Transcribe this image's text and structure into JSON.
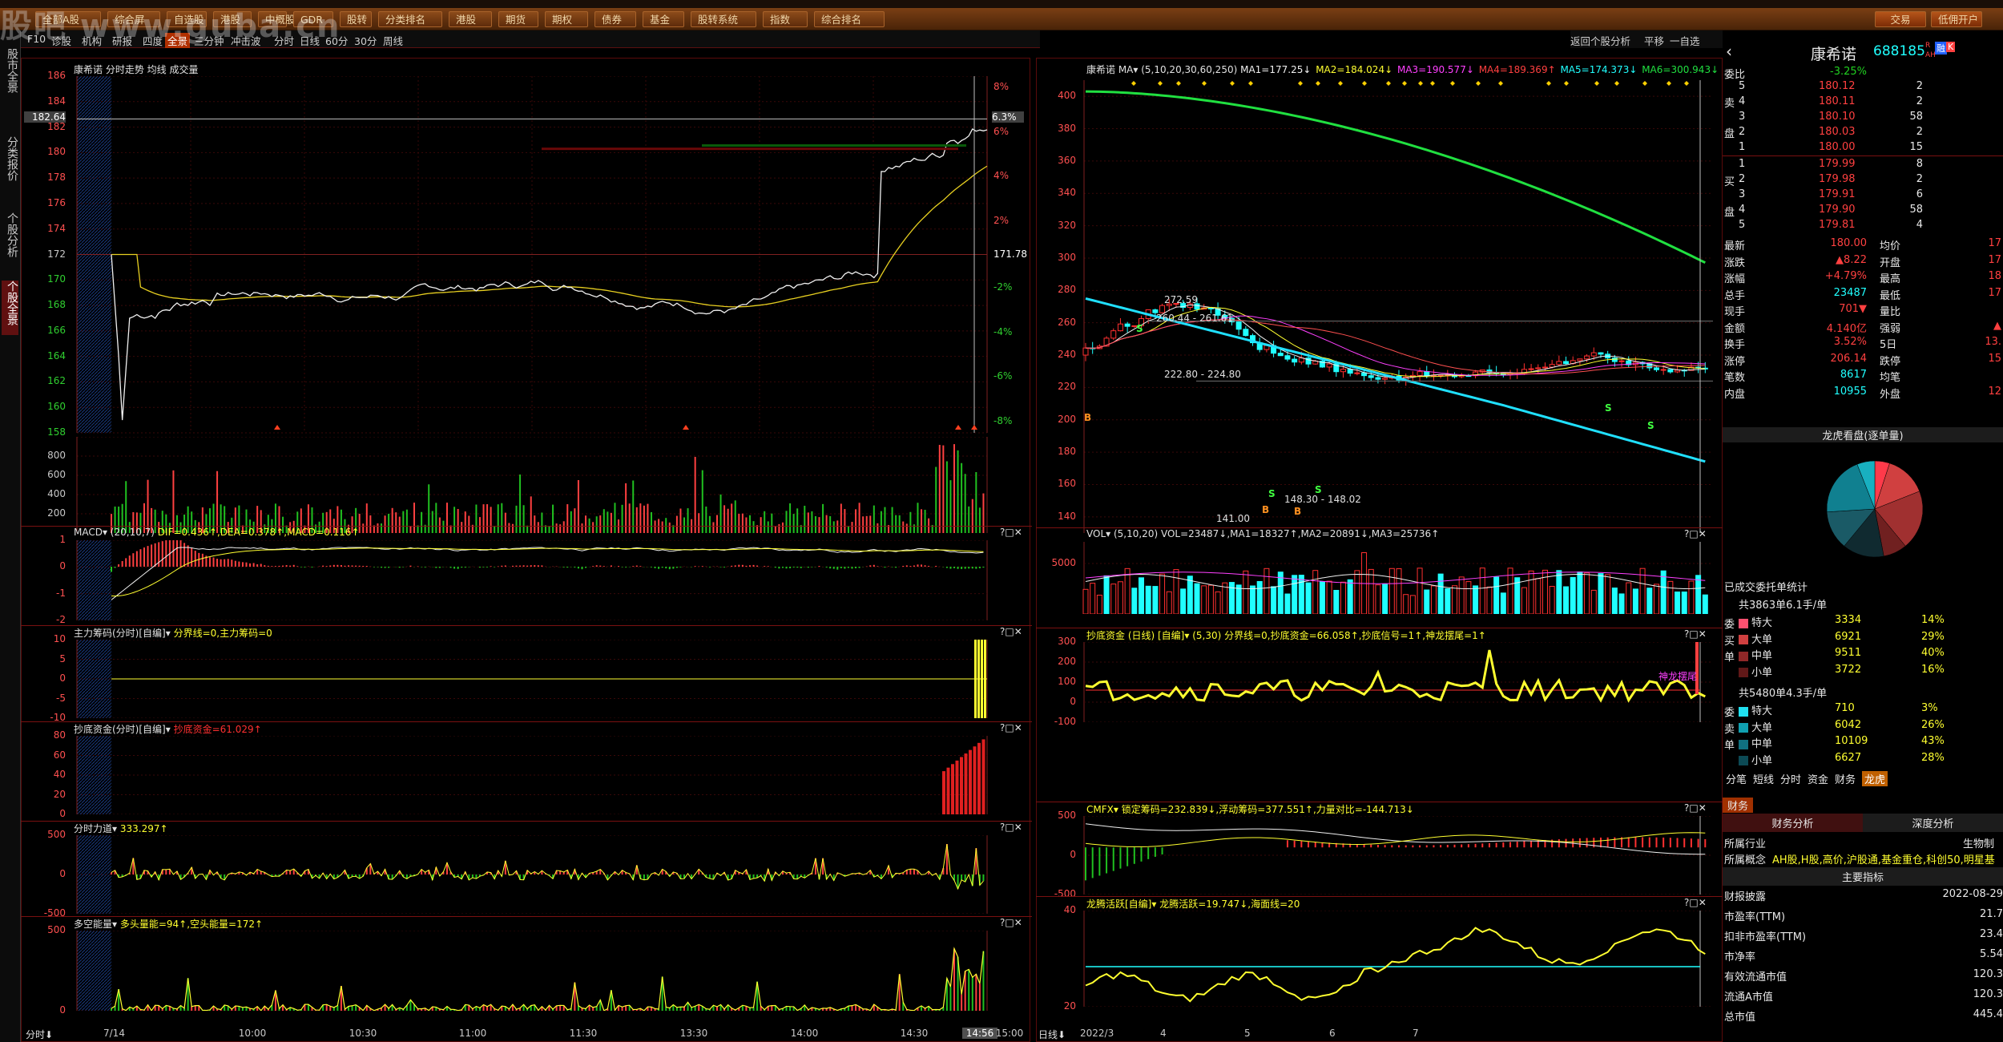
{
  "watermark": "股吧 www.guba.cn",
  "menu": [
    "全部",
    "全部A股",
    "综合屏",
    "自选股",
    "港股",
    "中概股",
    "GDR",
    "股转",
    "分类排名",
    "港股",
    "期货",
    "期权",
    "债券",
    "基金",
    "股转系统",
    "指数",
    "综合排名"
  ],
  "menu_right": [
    "交易",
    "低佣开户"
  ],
  "left_tabs": [
    "股市全景",
    "分类报价",
    "个股分析",
    "个股全景"
  ],
  "toolbar": [
    "F10",
    "诊股",
    "机构",
    "研报",
    "四度",
    "全景",
    "三分钟",
    "冲击波",
    "分时",
    "日线",
    "60分",
    "30分",
    "周线"
  ],
  "rtool": [
    "返回个股分析",
    "平移",
    "一自选"
  ],
  "intraday": {
    "header": "康希诺  分时走势 均线 成交量",
    "price_ticks": [
      "186",
      "184",
      "182",
      "180",
      "178",
      "176",
      "174",
      "172",
      "170",
      "168",
      "166",
      "164",
      "162",
      "160",
      "158"
    ],
    "pct_ticks": [
      "8%",
      "6%",
      "4%",
      "2%",
      "-2%",
      "-4%",
      "-6%",
      "-8%"
    ],
    "last_price_tag": "182.64",
    "last_pct_tag": "6.3%",
    "mid_price": "171.78",
    "vol_ticks": [
      "800",
      "600",
      "400",
      "200"
    ],
    "time_ticks": [
      "7/14",
      "10:00",
      "10:30",
      "11:00",
      "11:30",
      "13:30",
      "14:00",
      "14:30",
      "14:56",
      "15:00"
    ],
    "bottom_left": "分时",
    "ind": [
      {
        "title": "MACD",
        "params": "(20,10,7)",
        "vals": "DIF=0.436↑,DEA=0.378↑,MACD=0.116↑",
        "ticks": [
          "1",
          "0",
          "-1",
          "-2"
        ]
      },
      {
        "title": "主力筹码(分时)[自编]",
        "params": "",
        "vals": "分界线=0,主力筹码=0",
        "ticks": [
          "10",
          "5",
          "0",
          "-5",
          "-10"
        ]
      },
      {
        "title": "抄底资金(分时)[自编]",
        "params": "",
        "vals": "抄底资金=61.029↑",
        "ticks": [
          "80",
          "60",
          "40",
          "20",
          "0"
        ]
      },
      {
        "title": "分时力道",
        "params": "",
        "vals": "333.297↑",
        "ticks": [
          "500",
          "0",
          "-500"
        ]
      },
      {
        "title": "多空能量",
        "params": "",
        "vals": "多头量能=94↑,空头能量=172↑",
        "ticks": [
          "500",
          "0"
        ]
      }
    ]
  },
  "daily": {
    "header": "康希诺  MA▾ (5,10,20,30,60,250)",
    "ma": [
      "MA1=177.25↓",
      "MA2=184.024↓",
      "MA3=190.577↓",
      "MA4=189.369↑",
      "MA5=174.373↓",
      "MA6=300.943↓"
    ],
    "price_ticks": [
      "400",
      "380",
      "360",
      "340",
      "320",
      "300",
      "280",
      "260",
      "240",
      "220",
      "200",
      "180",
      "160",
      "140"
    ],
    "labels": [
      "272.59",
      "260.44 - 261.61",
      "222.80 - 224.80",
      "141.00",
      "148.30 - 148.02"
    ],
    "vol_header": "VOL▾ (5,10,20)  VOL=23487↓,MA1=18327↑,MA2=20891↓,MA3=25736↑",
    "vol_ticks": [
      "5000"
    ],
    "cdzj_header": "抄底资金 (日线) [自编]▾ (5,30)  分界线=0,抄底资金=66.058↑,抄底信号=1↑,神龙摆尾=1↑",
    "cdzj_ticks": [
      "300",
      "200",
      "100",
      "0",
      "-100"
    ],
    "cdzj_mark": "神龙摆尾",
    "cmfx_header": "CMFX▾  锁定筹码=232.839↓,浮动筹码=377.551↑,力量对比=-144.713↓",
    "cmfx_ticks": [
      "500",
      "0",
      "-500"
    ],
    "lt_header": "龙腾活跃[自编]▾ 龙腾活跃=19.747↓,海面线=20",
    "lt_ticks": [
      "40",
      "20"
    ],
    "dates": [
      "2022/3",
      "4",
      "5",
      "6",
      "7"
    ],
    "bottom_left": "日线"
  },
  "quote": {
    "name": "康希诺",
    "code": "688185",
    "badges": [
      "R",
      "AH",
      "融",
      "K"
    ],
    "webi_label": "委比",
    "webi": "-3.25%",
    "sell": [
      [
        "5",
        "180.12",
        "2"
      ],
      [
        "4",
        "180.11",
        "2"
      ],
      [
        "3",
        "180.10",
        "58"
      ],
      [
        "2",
        "180.03",
        "2"
      ],
      [
        "1",
        "180.00",
        "15"
      ]
    ],
    "buy": [
      [
        "1",
        "179.99",
        "8"
      ],
      [
        "2",
        "179.98",
        "2"
      ],
      [
        "3",
        "179.91",
        "6"
      ],
      [
        "4",
        "179.90",
        "58"
      ],
      [
        "5",
        "179.81",
        "4"
      ]
    ],
    "side_sell": [
      "卖",
      "盘"
    ],
    "side_buy": [
      "买",
      "盘"
    ],
    "stats": [
      [
        "最新",
        "180.00",
        "均价",
        "17"
      ],
      [
        "涨跌",
        "▲8.22",
        "开盘",
        "17"
      ],
      [
        "涨幅",
        "+4.79%",
        "最高",
        "18"
      ],
      [
        "总手",
        "23487",
        "最低",
        "17"
      ],
      [
        "现手",
        "701▼",
        "量比",
        ""
      ],
      [
        "金额",
        "4.140亿",
        "强弱",
        "▲"
      ],
      [
        "换手",
        "3.52%",
        "5日",
        "13."
      ],
      [
        "涨停",
        "206.14",
        "跌停",
        "15"
      ],
      [
        "笔数",
        "8617",
        "均笔",
        ""
      ],
      [
        "内盘",
        "10955",
        "外盘",
        "12"
      ]
    ],
    "pie_title": "龙虎看盘(逐单量)",
    "done_title": "已成交委托单统计",
    "buy_total": "共3863单6.1手/单",
    "buy_rows": [
      [
        "特大",
        "3334",
        "14%"
      ],
      [
        "大单",
        "6921",
        "29%"
      ],
      [
        "中单",
        "9511",
        "40%"
      ],
      [
        "小单",
        "3722",
        "16%"
      ]
    ],
    "sell_total": "共5480单4.3手/单",
    "sell_rows": [
      [
        "特大",
        "710",
        "3%"
      ],
      [
        "大单",
        "6042",
        "26%"
      ],
      [
        "中单",
        "10109",
        "43%"
      ],
      [
        "小单",
        "6627",
        "28%"
      ]
    ],
    "side_b": [
      "委",
      "买",
      "单"
    ],
    "side_s": [
      "委",
      "卖",
      "单"
    ],
    "tabs": [
      "分笔",
      "短线",
      "分时",
      "资金",
      "财务",
      "龙虎"
    ],
    "fin_tab": "财务",
    "fin_sub": [
      "财务分析",
      "深度分析"
    ],
    "industry_label": "所属行业",
    "industry": "生物制",
    "concept_label": "所属概念",
    "concept": "AH股,H股,高价,沪股通,基金重仓,科创50,明星基",
    "main_idx": "主要指标",
    "fin_rows": [
      [
        "财报披露",
        "2022-08-29"
      ],
      [
        "市盈率(TTM)",
        "21.7"
      ],
      [
        "扣非市盈率(TTM)",
        "23.4"
      ],
      [
        "市净率",
        "5.54"
      ],
      [
        "有效流通市值",
        "120.3"
      ],
      [
        "流通A市值",
        "120.3"
      ],
      [
        "总市值",
        "445.4"
      ]
    ]
  }
}
